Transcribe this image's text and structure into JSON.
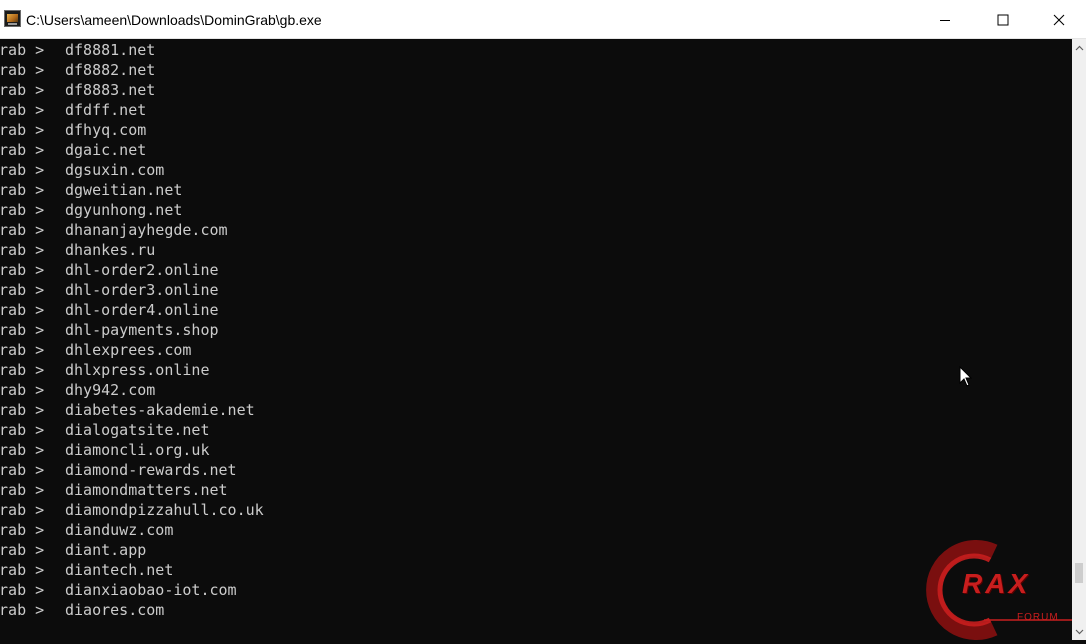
{
  "window": {
    "title": "C:\\Users\\ameen\\Downloads\\DominGrab\\gb.exe"
  },
  "console": {
    "prompt": "Grab >",
    "lines": [
      "df8881.net",
      "df8882.net",
      "df8883.net",
      "dfdff.net",
      "dfhyq.com",
      "dgaic.net",
      "dgsuxin.com",
      "dgweitian.net",
      "dgyunhong.net",
      "dhananjayhegde.com",
      "dhankes.ru",
      "dhl-order2.online",
      "dhl-order3.online",
      "dhl-order4.online",
      "dhl-payments.shop",
      "dhlexprees.com",
      "dhlxpress.online",
      "dhy942.com",
      "diabetes-akademie.net",
      "dialogatsite.net",
      "diamoncli.org.uk",
      "diamond-rewards.net",
      "diamondmatters.net",
      "diamondpizzahull.co.uk",
      "dianduwz.com",
      "diant.app",
      "diantech.net",
      "dianxiaobao-iot.com",
      "diaores.com"
    ]
  },
  "watermark": {
    "word": "RAX",
    "sub": "FORUM"
  },
  "icons": {
    "app": "console-app-icon",
    "minimize": "minimize-icon",
    "maximize": "maximize-icon",
    "close": "close-icon",
    "cursor": "mouse-cursor-icon"
  },
  "colors": {
    "console_bg": "#0c0c0c",
    "console_text": "#cccccc",
    "titlebar_bg": "#ffffff",
    "logo_red": "#c81e1e"
  }
}
